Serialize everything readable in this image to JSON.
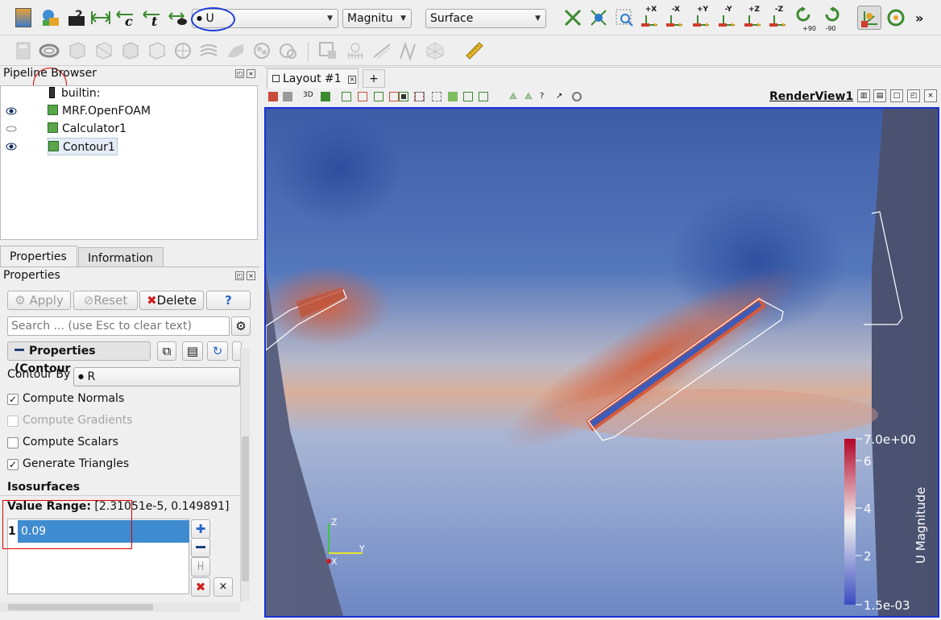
{
  "toolbar": {
    "array_combo": "U",
    "component_combo": "Magnitu",
    "representation_combo": "Surface",
    "camera_buttons": [
      "+X",
      "-X",
      "+Y",
      "-Y",
      "+Z",
      "-Z"
    ],
    "rotate_labels": [
      "+90",
      "-90"
    ],
    "overflow": "»"
  },
  "pipeline_browser": {
    "title": "Pipeline Browser",
    "items": [
      {
        "label": "builtin:"
      },
      {
        "label": "MRF.OpenFOAM"
      },
      {
        "label": "Calculator1"
      },
      {
        "label": "Contour1"
      }
    ]
  },
  "tabs": {
    "properties": "Properties",
    "information": "Information"
  },
  "properties": {
    "title": "Properties",
    "apply": "Apply",
    "reset": "Reset",
    "delete": "Delete",
    "help": "?",
    "search_placeholder": "Search ... (use Esc to clear text)",
    "section_title": "Properties (Contour",
    "contour_by_label": "Contour By",
    "contour_by_value": "R",
    "checkboxes": [
      {
        "label": "Compute Normals",
        "checked": true,
        "enabled": true
      },
      {
        "label": "Compute Gradients",
        "checked": false,
        "enabled": false
      },
      {
        "label": "Compute Scalars",
        "checked": false,
        "enabled": true
      },
      {
        "label": "Generate Triangles",
        "checked": true,
        "enabled": true
      }
    ],
    "isosurfaces_label": "Isosurfaces",
    "value_range_label": "Value Range:",
    "value_range_value": "[2.31051e-5, 0.149891]",
    "iso_rows": [
      {
        "index": "1",
        "value": "0.09"
      }
    ]
  },
  "layout": {
    "tab_label": "Layout #1",
    "add_tab": "+",
    "toolbar_3d": "3D",
    "view_name": "RenderView1"
  },
  "orientation_axes": {
    "z": "Z",
    "y": "Y",
    "x": "X"
  },
  "color_legend": {
    "title": "U Magnitude",
    "max": "7.0e+00",
    "min": "1.5e-03",
    "ticks": [
      "6",
      "4",
      "2"
    ],
    "colors": [
      "#b40426",
      "#f0f0f0",
      "#3b4cc0"
    ]
  }
}
